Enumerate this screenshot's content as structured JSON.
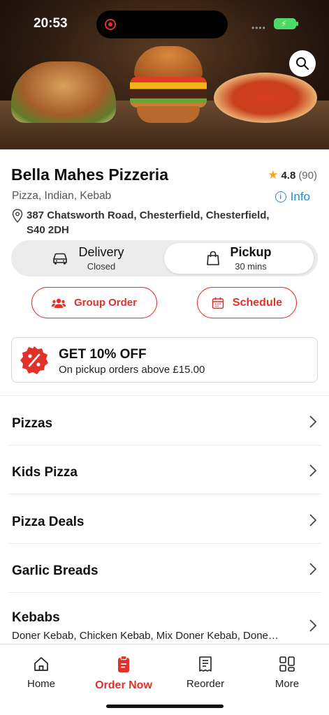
{
  "status_bar": {
    "time": "20:53",
    "signal": "••••"
  },
  "hero": {
    "search_icon": "search-icon"
  },
  "restaurant": {
    "name": "Bella Mahes Pizzeria",
    "rating": "4.8",
    "rating_count": "(90)",
    "cuisines": "Pizza, Indian, Kebab",
    "info_label": "Info",
    "address": "387 Chatsworth Road, Chesterfield, Chesterfield, S40 2DH"
  },
  "fulfilment": {
    "delivery": {
      "label": "Delivery",
      "status": "Closed"
    },
    "pickup": {
      "label": "Pickup",
      "status": "30 mins",
      "selected": true
    }
  },
  "actions": {
    "group_order": "Group Order",
    "schedule": "Schedule"
  },
  "offer": {
    "title": "GET 10% OFF",
    "description": "On pickup orders above £15.00"
  },
  "categories": [
    {
      "name": "Pizzas"
    },
    {
      "name": "Kids Pizza"
    },
    {
      "name": "Pizza Deals"
    },
    {
      "name": "Garlic Breads"
    },
    {
      "name": "Kebabs",
      "items": "Doner Kebab, Chicken Kebab, Mix Doner Kebab, Done…"
    }
  ],
  "nav": [
    {
      "label": "Home",
      "icon": "home-icon"
    },
    {
      "label": "Order Now",
      "icon": "order-icon",
      "active": true
    },
    {
      "label": "Reorder",
      "icon": "receipt-icon"
    },
    {
      "label": "More",
      "icon": "grid-icon"
    }
  ],
  "colors": {
    "accent": "#e0312b",
    "link": "#2a8dbf",
    "star": "#f5a623"
  }
}
